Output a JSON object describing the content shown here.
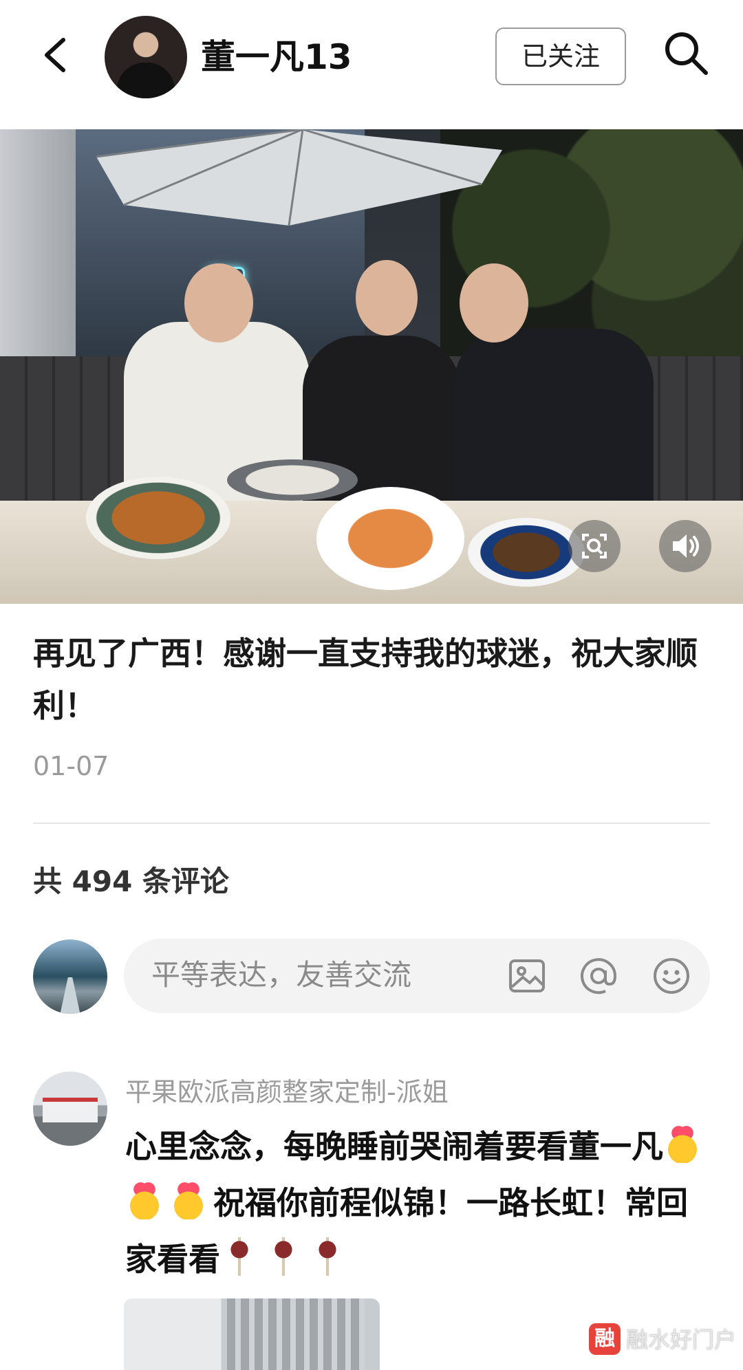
{
  "header": {
    "author_name": "董一凡13",
    "follow_label": "已关注",
    "back_icon": "chevron-left-icon",
    "search_icon": "search-icon"
  },
  "post": {
    "text": "再见了广西！感谢一直支持我的球迷，祝大家顺利！",
    "date": "01-07"
  },
  "comments_section": {
    "count_label": "共 494 条评论",
    "input_placeholder": "平等表达，友善交流"
  },
  "first_comment": {
    "author": "平果欧派高颜整家定制-派姐",
    "text_part1": "心里念念，每晚睡前哭闹着要看董一凡",
    "text_part2": "祝福你前程似锦！一路长虹！常回家看看"
  },
  "watermark": {
    "logo": "融",
    "text": "融水好门户"
  },
  "colors": {
    "accent_red": "#e8423c",
    "muted_text": "#9a9a9a"
  }
}
